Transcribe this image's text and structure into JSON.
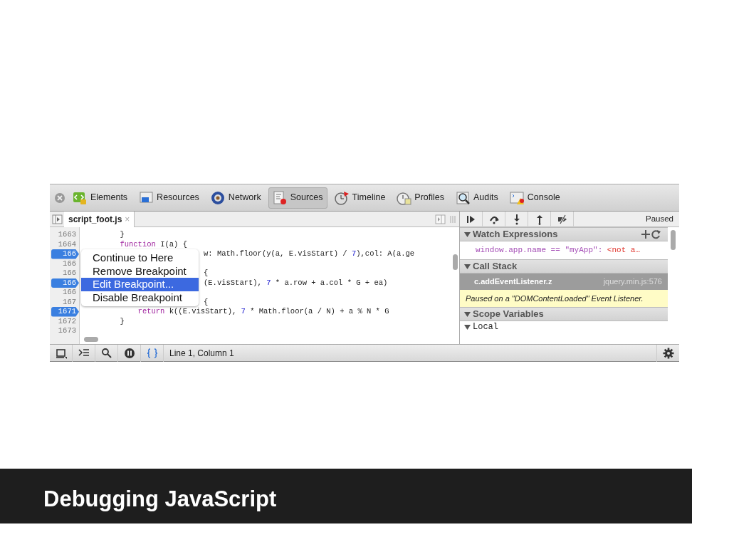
{
  "toolbar": {
    "tabs": [
      {
        "label": "Elements",
        "selected": false
      },
      {
        "label": "Resources",
        "selected": false
      },
      {
        "label": "Network",
        "selected": false
      },
      {
        "label": "Sources",
        "selected": true
      },
      {
        "label": "Timeline",
        "selected": false
      },
      {
        "label": "Profiles",
        "selected": false
      },
      {
        "label": "Audits",
        "selected": false
      },
      {
        "label": "Console",
        "selected": false
      }
    ]
  },
  "editor": {
    "file_tab": {
      "label": "script_foot.js",
      "close": "×"
    },
    "lines": [
      {
        "number": "1663",
        "breakpoint": false,
        "code": [
          {
            "kind": "plain",
            "text": "        }"
          }
        ]
      },
      {
        "number": "1664",
        "breakpoint": false,
        "code": [
          {
            "kind": "keyword",
            "text": "        function"
          },
          {
            "kind": "plain",
            "text": " I(a) {"
          }
        ]
      },
      {
        "number": "166",
        "breakpoint": true,
        "code": [
          {
            "kind": "plain",
            "text": "w: Math.floor(y(a, E.visStart) / "
          },
          {
            "kind": "number",
            "text": "7"
          },
          {
            "kind": "plain",
            "text": "),col: A(a.ge"
          }
        ]
      },
      {
        "number": "166",
        "breakpoint": false
      },
      {
        "number": "166",
        "breakpoint": false,
        "code": [
          {
            "kind": "plain",
            "text": "{"
          }
        ]
      },
      {
        "number": "166",
        "breakpoint": true,
        "code": [
          {
            "kind": "plain",
            "text": "(E.visStart), "
          },
          {
            "kind": "number",
            "text": "7"
          },
          {
            "kind": "plain",
            "text": " * a.row + a.col * G + ea)"
          }
        ]
      },
      {
        "number": "166",
        "breakpoint": false
      },
      {
        "number": "167",
        "breakpoint": false,
        "code": [
          {
            "kind": "plain",
            "text": "{"
          }
        ]
      },
      {
        "number": "1671",
        "breakpoint": true,
        "code": [
          {
            "kind": "keyword",
            "text": "            return"
          },
          {
            "kind": "plain",
            "text": " k((E.visStart), "
          },
          {
            "kind": "number",
            "text": "7"
          },
          {
            "kind": "plain",
            "text": " * Math.floor(a / N) + a % N * G"
          }
        ]
      },
      {
        "number": "1672",
        "breakpoint": false,
        "code": [
          {
            "kind": "plain",
            "text": "        }"
          }
        ]
      },
      {
        "number": "1673",
        "breakpoint": false
      }
    ],
    "context_menu": [
      {
        "label": "Continue to Here",
        "selected": false
      },
      {
        "label": "Remove Breakpoint",
        "selected": false
      },
      {
        "label": "Edit Breakpoint...",
        "selected": true
      },
      {
        "label": "Disable Breakpoint",
        "selected": false
      }
    ]
  },
  "debugger": {
    "status": "Paused",
    "watch": {
      "title": "Watch Expressions",
      "expanded": true,
      "expression": "window.app.name == \"myApp\": ",
      "result": "<not a…"
    },
    "call_stack": {
      "title": "Call Stack",
      "expanded": true,
      "frames": [
        {
          "name": "c.addEventListener.z",
          "location": "jquery.min.js:576",
          "selected": true
        }
      ],
      "notice": "Paused on a \"DOMContentLoaded\" Event Listener."
    },
    "scope": {
      "title": "Scope Variables",
      "expanded": true,
      "items": [
        {
          "label": "Local",
          "expanded": true
        }
      ]
    }
  },
  "status_bar": {
    "position": "Line 1, Column 1"
  },
  "slide_caption": "Debugging JavaScript"
}
